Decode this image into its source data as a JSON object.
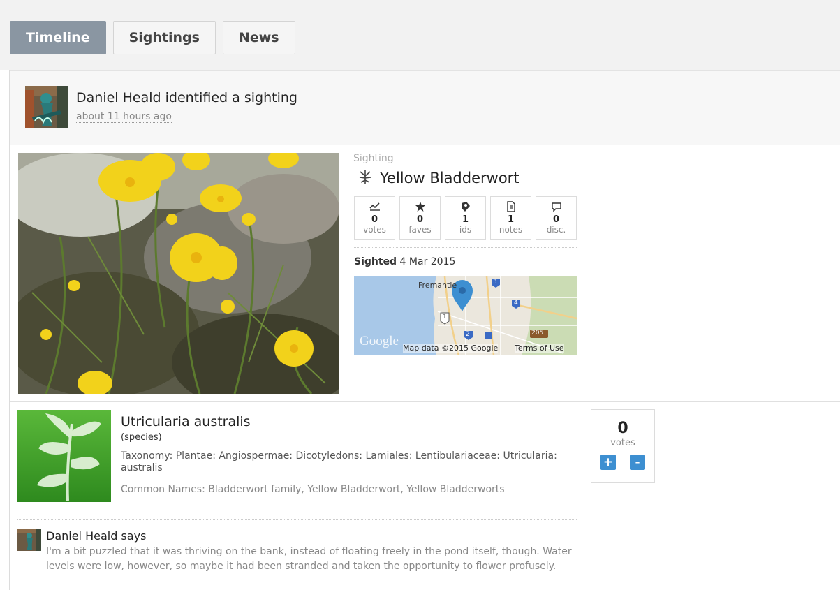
{
  "tabs": [
    {
      "label": "Timeline",
      "active": true
    },
    {
      "label": "Sightings",
      "active": false
    },
    {
      "label": "News",
      "active": false
    }
  ],
  "event": {
    "title": "Daniel Heald identified a sighting",
    "time": "about 11 hours ago"
  },
  "sighting": {
    "label": "Sighting",
    "title": "Yellow Bladderwort",
    "stats": [
      {
        "icon": "chart-line-icon",
        "count": "0",
        "label": "votes"
      },
      {
        "icon": "star-icon",
        "count": "0",
        "label": "faves"
      },
      {
        "icon": "id-tag-icon",
        "count": "1",
        "label": "ids"
      },
      {
        "icon": "notes-icon",
        "count": "1",
        "label": "notes"
      },
      {
        "icon": "speech-bubble-icon",
        "count": "0",
        "label": "disc."
      }
    ],
    "sighted_label": "Sighted",
    "sighted_date": "4 Mar 2015",
    "map": {
      "place": "Fremantle",
      "logo": "Google",
      "attribution": "Map data ©2015 Google",
      "terms": "Terms of Use",
      "shields": [
        "3",
        "4",
        "1",
        "2",
        "205"
      ]
    }
  },
  "species": {
    "name": "Utricularia australis",
    "rank": "(species)",
    "taxonomy": "Taxonomy: Plantae: Angiospermae: Dicotyledons: Lamiales: Lentibulariaceae: Utricularia: australis",
    "common_names": "Common Names: Bladderwort family, Yellow Bladderwort, Yellow Bladderworts",
    "votes_count": "0",
    "votes_label": "votes",
    "upvote": "+",
    "downvote": "-"
  },
  "comment": {
    "author": "Daniel Heald says",
    "text": "I'm a bit puzzled that it was thriving on the bank, instead of floating freely in the pond itself, though. Water levels were low, however, so maybe it had been stranded and taken the opportunity to flower profusely."
  },
  "colors": {
    "tab_active": "#8a96a2",
    "vote_button": "#3d8fd1",
    "map_pin": "#3d8fd1",
    "species_green": "#3a9a2a"
  }
}
